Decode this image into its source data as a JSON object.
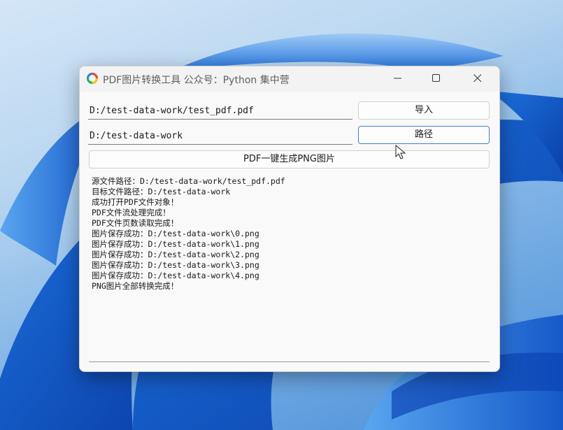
{
  "window": {
    "title": "PDF图片转换工具 公众号：Python 集中营"
  },
  "form": {
    "source_value": "D:/test-data-work/test_pdf.pdf",
    "target_value": "D:/test-data-work",
    "import_label": "导入",
    "path_label": "路径",
    "convert_label": "PDF一键生成PNG图片"
  },
  "log": [
    "源文件路径：D:/test-data-work/test_pdf.pdf",
    "目标文件路径：D:/test-data-work",
    "成功打开PDF文件对象！",
    "PDF文件流处理完成！",
    "PDF文件页数读取完成！",
    "图片保存成功：D:/test-data-work\\0.png",
    "图片保存成功：D:/test-data-work\\1.png",
    "图片保存成功：D:/test-data-work\\2.png",
    "图片保存成功：D:/test-data-work\\3.png",
    "图片保存成功：D:/test-data-work\\4.png",
    "PNG图片全部转换完成！"
  ],
  "icons": {
    "app": "color-wheel-icon",
    "minimize": "minimize-icon",
    "maximize": "maximize-icon",
    "close": "close-icon"
  },
  "colors": {
    "focus_border": "#3e7fd6",
    "wallpaper_blue": "#1a6fdc"
  }
}
